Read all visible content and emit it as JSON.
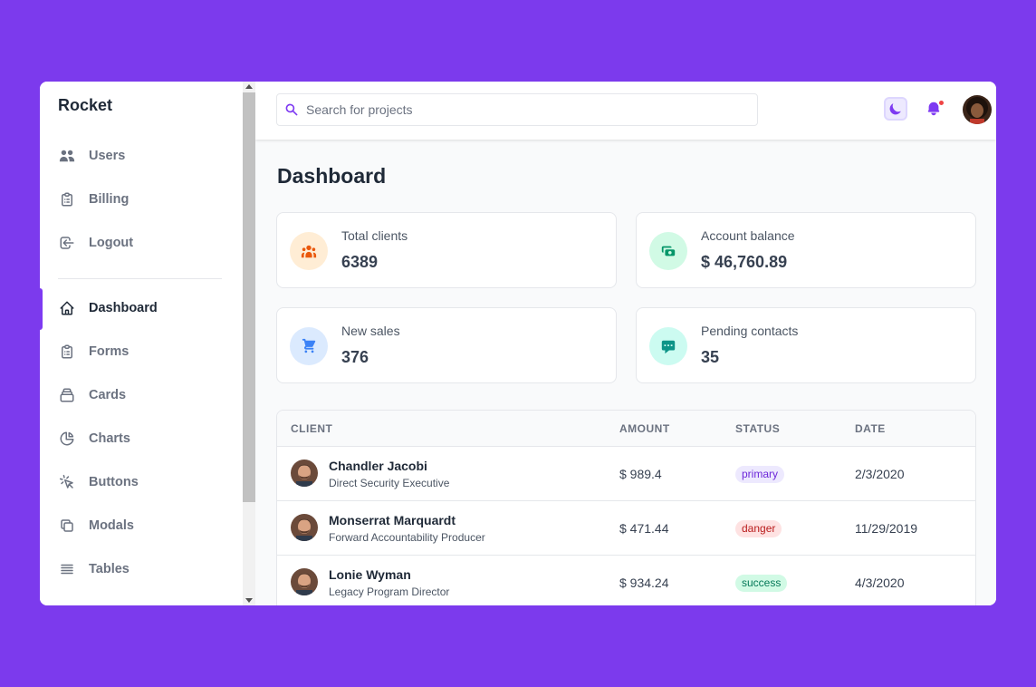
{
  "sidebar": {
    "brand": "Rocket",
    "items": [
      {
        "label": "Users",
        "icon": "users-icon"
      },
      {
        "label": "Billing",
        "icon": "clipboard-icon"
      },
      {
        "label": "Logout",
        "icon": "logout-icon"
      },
      {
        "label": "Dashboard",
        "icon": "home-icon",
        "active": true
      },
      {
        "label": "Forms",
        "icon": "clipboard-icon"
      },
      {
        "label": "Cards",
        "icon": "cards-icon"
      },
      {
        "label": "Charts",
        "icon": "pie-chart-icon"
      },
      {
        "label": "Buttons",
        "icon": "cursor-click-icon"
      },
      {
        "label": "Modals",
        "icon": "duplicate-icon"
      },
      {
        "label": "Tables",
        "icon": "table-icon"
      }
    ]
  },
  "header": {
    "search_placeholder": "Search for projects",
    "has_notification": true
  },
  "main": {
    "title": "Dashboard",
    "cards": [
      {
        "label": "Total clients",
        "value": "6389",
        "icon": "users-icon",
        "color": "#ea580c",
        "bg": "#ffedd5"
      },
      {
        "label": "Account balance",
        "value": "$ 46,760.89",
        "icon": "cash-icon",
        "color": "#059669",
        "bg": "#d1fae5"
      },
      {
        "label": "New sales",
        "value": "376",
        "icon": "cart-icon",
        "color": "#3b82f6",
        "bg": "#dbeafe"
      },
      {
        "label": "Pending contacts",
        "value": "35",
        "icon": "chat-icon",
        "color": "#0d9488",
        "bg": "#ccfbf1"
      }
    ],
    "table": {
      "headers": [
        "CLIENT",
        "AMOUNT",
        "STATUS",
        "DATE"
      ],
      "rows": [
        {
          "name": "Chandler Jacobi",
          "role": "Direct Security Executive",
          "amount": "$ 989.4",
          "status": "primary",
          "date": "2/3/2020"
        },
        {
          "name": "Monserrat Marquardt",
          "role": "Forward Accountability Producer",
          "amount": "$ 471.44",
          "status": "danger",
          "date": "11/29/2019"
        },
        {
          "name": "Lonie Wyman",
          "role": "Legacy Program Director",
          "amount": "$ 934.24",
          "status": "success",
          "date": "4/3/2020"
        }
      ]
    }
  },
  "colors": {
    "accent": "#7e3af2",
    "background": "#7c3aed",
    "badge_primary_bg": "#ede9fe",
    "badge_primary_fg": "#6d28d9",
    "badge_danger_bg": "#fee2e2",
    "badge_danger_fg": "#b91c1c",
    "badge_success_bg": "#d1fae5",
    "badge_success_fg": "#047857"
  }
}
